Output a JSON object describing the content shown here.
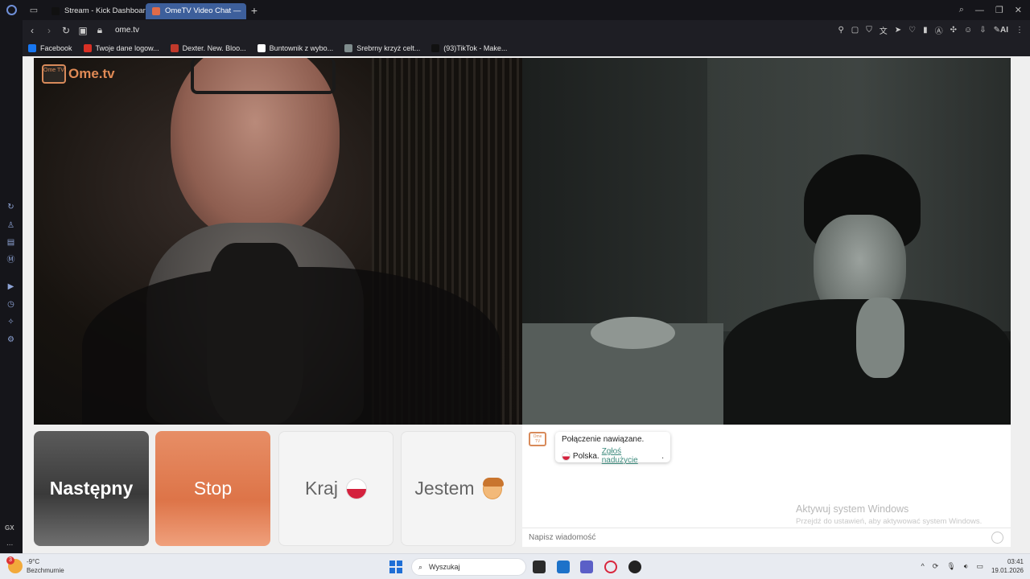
{
  "browser": {
    "tabs": [
      {
        "label": "Stream - Kick Dashboard",
        "active": false
      },
      {
        "label": "OmeTV Video Chat — ",
        "active": true
      }
    ],
    "url": "ome.tv",
    "ai_label": "AI",
    "bookmarks": [
      {
        "label": "Facebook",
        "color": "#1877f2"
      },
      {
        "label": "Twoje dane logow...",
        "color": "#d93025"
      },
      {
        "label": "Dexter. New. Bloo...",
        "color": "#c0392b"
      },
      {
        "label": "Buntownik z wybo...",
        "color": "#ffffff"
      },
      {
        "label": "Srebrny krzyż celt...",
        "color": "#7f8c8d"
      },
      {
        "label": "(93)TikTok - Make...",
        "color": "#111111"
      }
    ]
  },
  "sidebar": {
    "gx_label": "GX",
    "more_label": "..."
  },
  "ometv": {
    "logo_small": "Ome TV",
    "logo_text": "Ome.tv",
    "buttons": {
      "next": "Następny",
      "stop": "Stop",
      "country": "Kraj",
      "i_am": "Jestem"
    },
    "chat": {
      "connection": "Połączenie nawiązane.",
      "country": "Polska.",
      "report": "Zgłoś nadużycie",
      "report_suffix": ".",
      "input_placeholder": "Napisz wiadomość"
    },
    "watermark": {
      "line1": "Aktywuj system Windows",
      "line2": "Przejdź do ustawień, aby aktywować system Windows."
    }
  },
  "taskbar": {
    "weather_badge": "3",
    "temperature": "-9°C",
    "condition": "Bezchmurnie",
    "search": "Wyszukaj",
    "time": "03:41",
    "date": "19.01.2026"
  }
}
